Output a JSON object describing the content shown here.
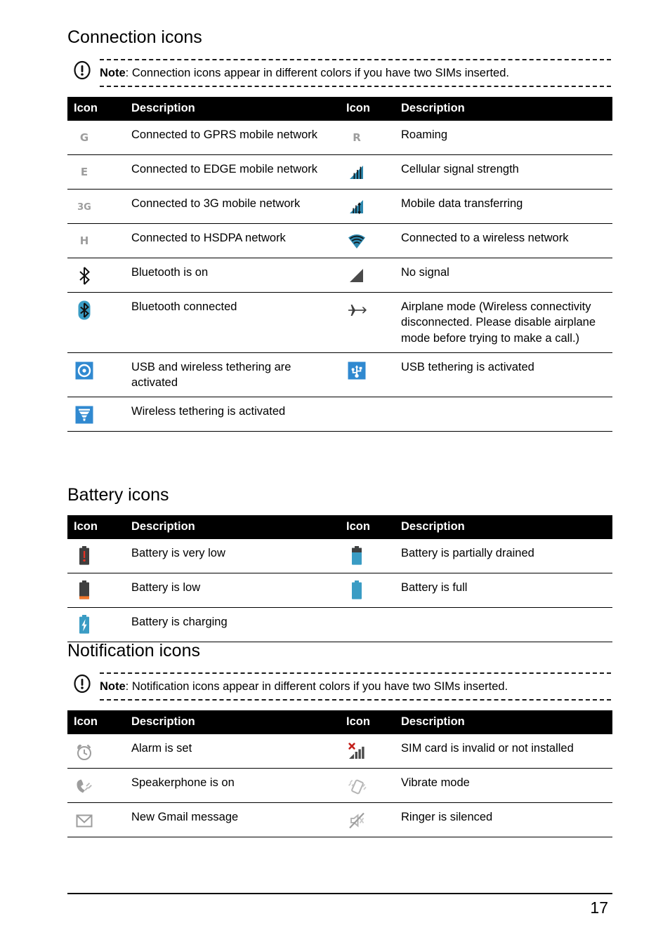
{
  "page": {
    "number": "17"
  },
  "sections": [
    {
      "id": "connection",
      "title": "Connection icons",
      "note": {
        "label": "Note",
        "separator": ": ",
        "text": "Connection icons appear in different colors if you have two SIMs inserted."
      },
      "table": {
        "headers": [
          "Icon",
          "Description",
          "Icon",
          "Description"
        ],
        "rows": [
          {
            "left_icon": "gprs-g-icon",
            "left_text": "Connected to GPRS mobile network",
            "right_icon": "roaming-r-icon",
            "right_text": "Roaming"
          },
          {
            "left_icon": "edge-e-icon",
            "left_text": "Connected to EDGE mobile network",
            "right_icon": "cellular-signal-icon",
            "right_text": "Cellular signal strength"
          },
          {
            "left_icon": "3g-icon",
            "left_text": "Connected to 3G mobile network",
            "right_icon": "mobile-data-transfer-icon",
            "right_text": "Mobile data transferring"
          },
          {
            "left_icon": "hsdpa-h-icon",
            "left_text": "Connected to HSDPA network",
            "right_icon": "wifi-icon",
            "right_text": "Connected to a wireless network"
          },
          {
            "left_icon": "bluetooth-on-icon",
            "left_text": "Bluetooth is on",
            "right_icon": "no-signal-icon",
            "right_text": "No signal"
          },
          {
            "left_icon": "bluetooth-connected-icon",
            "left_text": "Bluetooth connected",
            "right_icon": "airplane-mode-icon",
            "right_text": "Airplane mode (Wireless connectivity disconnected. Please disable airplane mode before trying to make a call.)"
          },
          {
            "left_icon": "usb-wireless-tethering-icon",
            "left_text": "USB and wireless tethering are activated",
            "right_icon": "usb-tethering-icon",
            "right_text": "USB tethering is activated"
          },
          {
            "left_icon": "wireless-tethering-icon",
            "left_text": "Wireless tethering is activated",
            "right_icon": "",
            "right_text": ""
          }
        ]
      }
    },
    {
      "id": "battery",
      "title": "Battery icons",
      "note": null,
      "table": {
        "headers": [
          "Icon",
          "Description",
          "Icon",
          "Description"
        ],
        "rows": [
          {
            "left_icon": "battery-very-low-icon",
            "left_text": "Battery is very low",
            "right_icon": "battery-partially-drained-icon",
            "right_text": "Battery is partially drained"
          },
          {
            "left_icon": "battery-low-icon",
            "left_text": "Battery is low",
            "right_icon": "battery-full-icon",
            "right_text": "Battery is full"
          },
          {
            "left_icon": "battery-charging-icon",
            "left_text": "Battery is charging",
            "right_icon": "",
            "right_text": ""
          }
        ]
      }
    },
    {
      "id": "notification",
      "title": "Notification icons",
      "note": {
        "label": "Note",
        "separator": ": ",
        "text": "Notification icons appear in different colors if you have two SIMs inserted."
      },
      "table": {
        "headers": [
          "Icon",
          "Description",
          "Icon",
          "Description"
        ],
        "rows": [
          {
            "left_icon": "alarm-icon",
            "left_text": "Alarm is set",
            "right_icon": "sim-invalid-icon",
            "right_text": "SIM card is invalid or not installed"
          },
          {
            "left_icon": "speakerphone-icon",
            "left_text": "Speakerphone is on",
            "right_icon": "vibrate-icon",
            "right_text": "Vibrate mode"
          },
          {
            "left_icon": "gmail-icon",
            "left_text": "New Gmail message",
            "right_icon": "ringer-silenced-icon",
            "right_text": "Ringer is silenced"
          }
        ]
      }
    }
  ],
  "icon_letters": {
    "gprs-g-icon": "G",
    "roaming-r-icon": "R",
    "edge-e-icon": "E",
    "3g-icon": "3G",
    "hsdpa-h-icon": "H"
  },
  "colors": {
    "accent_blue": "#3089d0",
    "signal_teal": "#2d87ad",
    "battery_teal": "#3a9cc4",
    "battery_dark": "#3f3f3f",
    "battery_orange": "#f2772b",
    "battery_red": "#e33224",
    "icon_gray": "#9d9d9d",
    "header_bg": "#000000",
    "no_signal_gray": "#4a4a4a",
    "sim_x_red": "#c4211c"
  }
}
